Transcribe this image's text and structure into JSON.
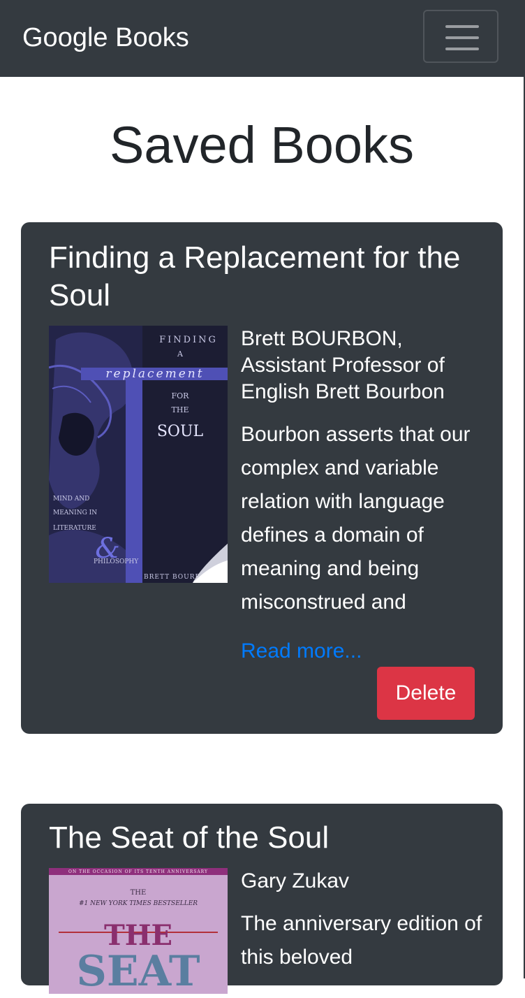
{
  "navbar": {
    "brand": "Google Books",
    "toggler_icon": "hamburger-menu-icon"
  },
  "page": {
    "title": "Saved Books"
  },
  "books": [
    {
      "title": "Finding a Replacement for the Soul",
      "authors": "Brett BOURBON, Assistant Professor of English Brett Bourbon",
      "description": "Bourbon asserts that our complex and variable relation with language defines a domain of meaning and being misconstrued and",
      "read_more_label": "Read more...",
      "delete_label": "Delete",
      "cover": {
        "text_finding": "FINDING",
        "text_a": "A",
        "text_replacement": "replacement",
        "text_for": "FOR",
        "text_the": "THE",
        "text_soul": "SOUL",
        "text_mind_and": "MIND AND",
        "text_meaning_in": "MEANING IN",
        "text_literature": "LITERATURE",
        "text_ampersand": "&",
        "text_philosophy": "PHILOSOPHY",
        "text_author": "BRETT BOURB"
      }
    },
    {
      "title": "The Seat of the Soul",
      "authors": "Gary Zukav",
      "description": "The anniversary edition of this beloved",
      "cover": {
        "text_banner": "ON THE OCCASION OF ITS TENTH ANNIVERSARY",
        "text_the_small": "THE",
        "text_bestseller": "#1 NEW YORK TIMES BESTSELLER",
        "text_the_big": "THE",
        "text_seat": "SEAT"
      }
    }
  ],
  "colors": {
    "navbar_bg": "#343a40",
    "card_bg": "#343a40",
    "link": "#007bff",
    "danger": "#dc3545"
  }
}
